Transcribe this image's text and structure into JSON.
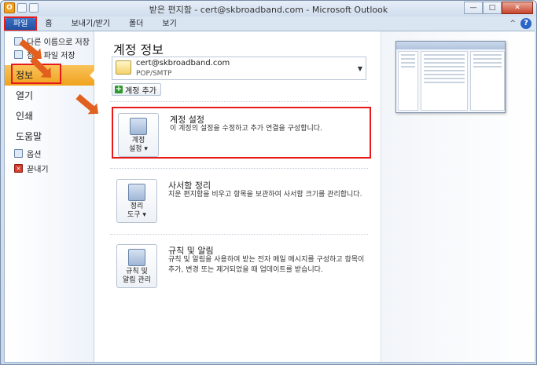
{
  "window": {
    "title": "받은 편지함 - cert@skbroadband.com - Microsoft Outlook",
    "app_icon_letter": "O",
    "controls": {
      "minimize": "—",
      "maximize": "□",
      "close": "✕"
    }
  },
  "ribbon": {
    "tabs": [
      "파일",
      "홈",
      "보내기/받기",
      "폴더",
      "보기"
    ],
    "help_icon": "?",
    "collapse_caret": "^"
  },
  "nav": {
    "save_as": "다른 이름으로 저장",
    "save_attachments": "첨부 파일 저장",
    "info": "정보",
    "open": "열기",
    "print": "인쇄",
    "help": "도움말",
    "options": "옵션",
    "exit": "끝내기"
  },
  "account": {
    "page_title": "계정 정보",
    "email": "cert@skbroadband.com",
    "type": "POP/SMTP",
    "add_account": "계정 추가"
  },
  "sections": [
    {
      "button": "계정\n설정 ▾",
      "title": "계정 설정",
      "desc": "이 계정의 설정을 수정하고 추가 연결을 구성합니다."
    },
    {
      "button": "정리\n도구 ▾",
      "title": "사서함 정리",
      "desc": "지운 편지함을 비우고 항목을 보관하여 사서함 크기를 관리합니다."
    },
    {
      "button": "규칙 및\n알림 관리",
      "title": "규칙 및 알림",
      "desc": "규칙 및 알림을 사용하여 받는 전자 메일 메시지를 구성하고 항목이 추가, 변경 또는 제거되었을 때 업데이트를 받습니다."
    }
  ],
  "colors": {
    "highlight": "#e8191b",
    "arrow": "#e2601f",
    "active_nav": "#f0a21e",
    "file_tab": "#1f4fa0"
  }
}
